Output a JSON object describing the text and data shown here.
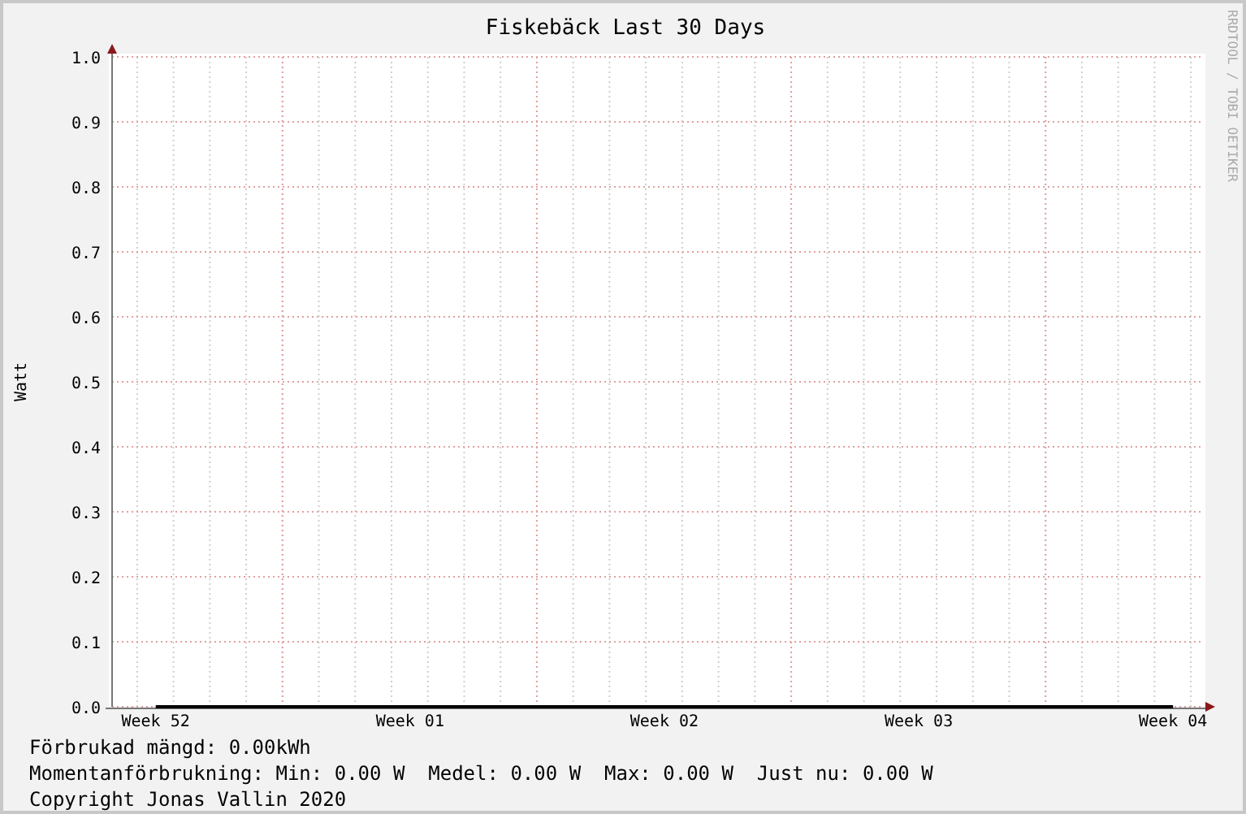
{
  "chart_data": {
    "type": "line",
    "title": "Fiskebäck Last 30 Days",
    "ylabel": "Watt",
    "categories": [
      "Week 52",
      "Week 01",
      "Week 02",
      "Week 03",
      "Week 04"
    ],
    "series": [
      {
        "color": "#000000",
        "values": [
          0,
          0,
          0,
          0,
          0
        ]
      }
    ],
    "ylim": [
      0,
      1
    ],
    "grid": true,
    "yticks": [
      {
        "value": 0,
        "label": "0.0"
      },
      {
        "value": 0.1,
        "label": "0.1"
      },
      {
        "value": 0.2,
        "label": "0.2"
      },
      {
        "value": 0.3,
        "label": "0.3"
      },
      {
        "value": 0.4,
        "label": "0.4"
      },
      {
        "value": 0.5,
        "label": "0.5"
      },
      {
        "value": 0.6,
        "label": "0.6"
      },
      {
        "value": 0.7,
        "label": "0.7"
      },
      {
        "value": 0.8,
        "label": "0.8"
      },
      {
        "value": 0.9,
        "label": "0.9"
      },
      {
        "value": 1,
        "label": "1.0"
      }
    ]
  },
  "watermark_side": "RRDTOOL / TOBI OETIKER",
  "legend": [
    "Förbrukad mängd: 0.00kWh",
    "Momentanförbrukning: Min: 0.00 W  Medel: 0.00 W  Max: 0.00 W  Just nu: 0.00 W",
    "Copyright Jonas Vallin 2020"
  ]
}
